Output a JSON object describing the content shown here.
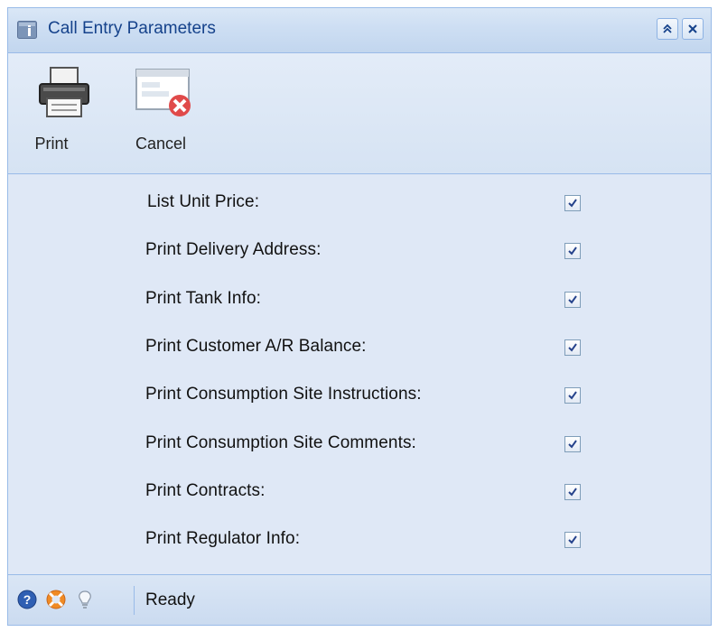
{
  "window": {
    "title": "Call Entry Parameters"
  },
  "toolbar": {
    "print_label": "Print",
    "cancel_label": "Cancel"
  },
  "options": [
    {
      "label": "List Unit Price:",
      "checked": true
    },
    {
      "label": "Print Delivery Address:",
      "checked": true
    },
    {
      "label": "Print Tank Info:",
      "checked": true
    },
    {
      "label": "Print Customer A/R Balance:",
      "checked": true
    },
    {
      "label": "Print Consumption Site Instructions:",
      "checked": true
    },
    {
      "label": "Print Consumption Site Comments:",
      "checked": true
    },
    {
      "label": "Print Contracts:",
      "checked": true
    },
    {
      "label": "Print Regulator Info:",
      "checked": true
    }
  ],
  "statusbar": {
    "status_text": "Ready",
    "icons": [
      "help-icon",
      "support-icon",
      "lightbulb-icon"
    ]
  },
  "colors": {
    "title_text": "#15428b",
    "border": "#99bbe8",
    "panel_bg": "#dfe8f6"
  }
}
